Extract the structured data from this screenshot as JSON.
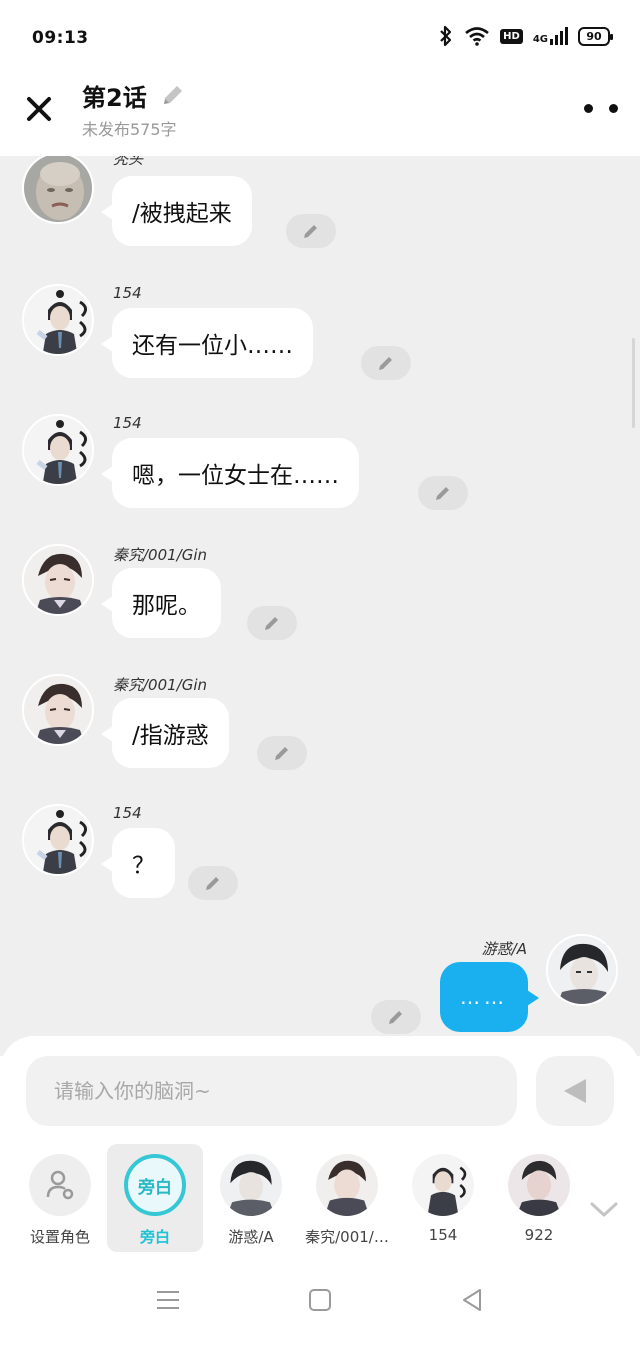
{
  "status_bar": {
    "time": "09:13",
    "network": "4G",
    "hd": "HD",
    "battery": "90"
  },
  "header": {
    "title": "第2话",
    "subtitle": "未发布575字"
  },
  "messages": [
    {
      "speaker": "秃头",
      "text": "/被拽起来",
      "avatar": "bald-head-avatar"
    },
    {
      "speaker": "154",
      "text": "还有一位小……",
      "avatar": "suit-character-avatar"
    },
    {
      "speaker": "154",
      "text": "嗯，一位女士在……",
      "avatar": "suit-character-avatar"
    },
    {
      "speaker": "秦究/001/Gin",
      "text": "那呢。",
      "avatar": "qinjiu-avatar"
    },
    {
      "speaker": "秦究/001/Gin",
      "text": "/指游惑",
      "avatar": "qinjiu-avatar"
    },
    {
      "speaker": "154",
      "text": "？",
      "avatar": "suit-character-avatar"
    },
    {
      "speaker": "游惑/A",
      "text": "……",
      "avatar": "youhuo-avatar",
      "self": true
    }
  ],
  "composer": {
    "placeholder": "请输入你的脑洞~"
  },
  "roles": [
    {
      "label": "设置角色",
      "avatar": "setup-role-icon"
    },
    {
      "label": "旁白",
      "circle_text": "旁白",
      "active": true
    },
    {
      "label": "游惑/A",
      "avatar": "youhuo-avatar"
    },
    {
      "label": "秦究/001/…",
      "avatar": "qinjiu-avatar"
    },
    {
      "label": "154",
      "avatar": "suit-character-avatar"
    },
    {
      "label": "922",
      "avatar": "922-avatar"
    }
  ],
  "colors": {
    "accent": "#1ab0f0",
    "aside": "#35c7d4",
    "chat_bg": "#efefef"
  }
}
